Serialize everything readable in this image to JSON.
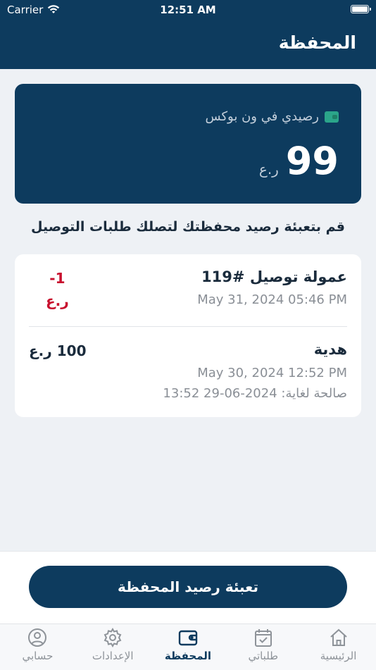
{
  "status_bar": {
    "carrier": "Carrier",
    "time": "12:51 AM"
  },
  "header": {
    "title": "المحفظة"
  },
  "balance": {
    "label": "رصيدي في ون بوكس",
    "amount": "99",
    "currency": "ر.ع"
  },
  "hint": "قم بتعبئة رصيد محفظتك لتصلك طلبات التوصيل",
  "transactions": [
    {
      "title": "عمولة توصيل #119",
      "date": "May 31, 2024 05:46 PM",
      "amount": "-1",
      "currency": "ر.ع"
    },
    {
      "title": "هدية",
      "date": "May 30, 2024 12:52 PM",
      "amount": "100 ر.ع",
      "valid": "صالحة لغاية: 2024-06-29 13:52"
    }
  ],
  "topup_button": "تعبئة رصيد المحفظة",
  "tabs": [
    {
      "label": "حسابي",
      "icon": "person-icon",
      "active": false
    },
    {
      "label": "الإعدادات",
      "icon": "gear-icon",
      "active": false
    },
    {
      "label": "المحفظة",
      "icon": "wallet-icon",
      "active": true
    },
    {
      "label": "طلباتي",
      "icon": "calendar-check-icon",
      "active": false
    },
    {
      "label": "الرئيسية",
      "icon": "home-icon",
      "active": false
    }
  ],
  "colors": {
    "primary": "#0d3b5e",
    "negative": "#c8102e",
    "accent": "#2ba58a"
  }
}
